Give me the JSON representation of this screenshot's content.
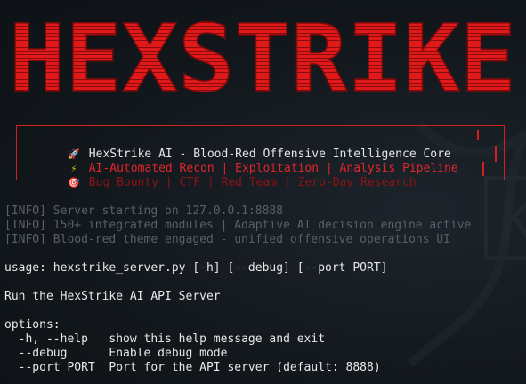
{
  "banner": {
    "title": "HEXSTRIKE",
    "color": "#e01a1a"
  },
  "infobox": {
    "lines": [
      {
        "icon": "rocket-icon",
        "glyph": "🚀",
        "text": "HexStrike AI - Blood-Red Offensive Intelligence Core"
      },
      {
        "icon": "lightning-icon",
        "glyph": "⚡",
        "text": "AI-Automated Recon | Exploitation | Analysis Pipeline"
      },
      {
        "icon": "target-icon",
        "glyph": "🎯",
        "text": "Bug Bounty | CTF | Red Team | Zero-Day Research"
      }
    ]
  },
  "logs": [
    "[INFO] Server starting on 127.0.0.1:8888",
    "[INFO] 150+ integrated modules | Adaptive AI decision engine active",
    "[INFO] Blood-red theme engaged - unified offensive operations UI"
  ],
  "usage": "usage: hexstrike_server.py [-h] [--debug] [--port PORT]",
  "description": "Run the HexStrike AI API Server",
  "options_header": "options:",
  "options": [
    "  -h, --help   show this help message and exit",
    "  --debug      Enable debug mode",
    "  --port PORT  Port for the API server (default: 8888)"
  ],
  "colors": {
    "accent": "#e0262a",
    "background": "#11161b",
    "info_gray": "#5a6068"
  }
}
